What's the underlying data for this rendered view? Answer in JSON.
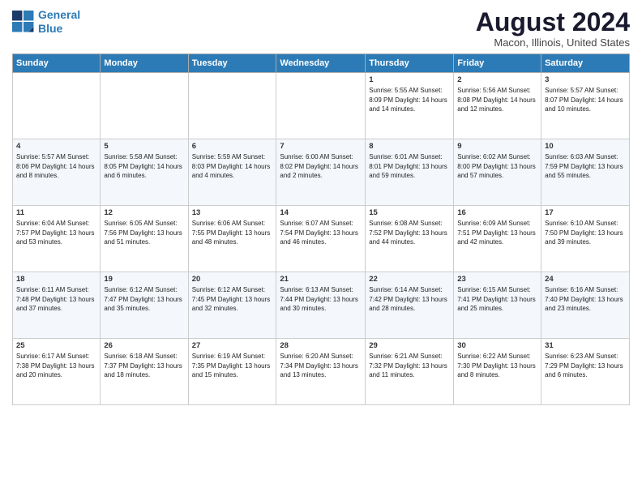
{
  "header": {
    "logo_line1": "General",
    "logo_line2": "Blue",
    "title": "August 2024",
    "subtitle": "Macon, Illinois, United States"
  },
  "weekdays": [
    "Sunday",
    "Monday",
    "Tuesday",
    "Wednesday",
    "Thursday",
    "Friday",
    "Saturday"
  ],
  "weeks": [
    [
      {
        "day": "",
        "info": ""
      },
      {
        "day": "",
        "info": ""
      },
      {
        "day": "",
        "info": ""
      },
      {
        "day": "",
        "info": ""
      },
      {
        "day": "1",
        "info": "Sunrise: 5:55 AM\nSunset: 8:09 PM\nDaylight: 14 hours\nand 14 minutes."
      },
      {
        "day": "2",
        "info": "Sunrise: 5:56 AM\nSunset: 8:08 PM\nDaylight: 14 hours\nand 12 minutes."
      },
      {
        "day": "3",
        "info": "Sunrise: 5:57 AM\nSunset: 8:07 PM\nDaylight: 14 hours\nand 10 minutes."
      }
    ],
    [
      {
        "day": "4",
        "info": "Sunrise: 5:57 AM\nSunset: 8:06 PM\nDaylight: 14 hours\nand 8 minutes."
      },
      {
        "day": "5",
        "info": "Sunrise: 5:58 AM\nSunset: 8:05 PM\nDaylight: 14 hours\nand 6 minutes."
      },
      {
        "day": "6",
        "info": "Sunrise: 5:59 AM\nSunset: 8:03 PM\nDaylight: 14 hours\nand 4 minutes."
      },
      {
        "day": "7",
        "info": "Sunrise: 6:00 AM\nSunset: 8:02 PM\nDaylight: 14 hours\nand 2 minutes."
      },
      {
        "day": "8",
        "info": "Sunrise: 6:01 AM\nSunset: 8:01 PM\nDaylight: 13 hours\nand 59 minutes."
      },
      {
        "day": "9",
        "info": "Sunrise: 6:02 AM\nSunset: 8:00 PM\nDaylight: 13 hours\nand 57 minutes."
      },
      {
        "day": "10",
        "info": "Sunrise: 6:03 AM\nSunset: 7:59 PM\nDaylight: 13 hours\nand 55 minutes."
      }
    ],
    [
      {
        "day": "11",
        "info": "Sunrise: 6:04 AM\nSunset: 7:57 PM\nDaylight: 13 hours\nand 53 minutes."
      },
      {
        "day": "12",
        "info": "Sunrise: 6:05 AM\nSunset: 7:56 PM\nDaylight: 13 hours\nand 51 minutes."
      },
      {
        "day": "13",
        "info": "Sunrise: 6:06 AM\nSunset: 7:55 PM\nDaylight: 13 hours\nand 48 minutes."
      },
      {
        "day": "14",
        "info": "Sunrise: 6:07 AM\nSunset: 7:54 PM\nDaylight: 13 hours\nand 46 minutes."
      },
      {
        "day": "15",
        "info": "Sunrise: 6:08 AM\nSunset: 7:52 PM\nDaylight: 13 hours\nand 44 minutes."
      },
      {
        "day": "16",
        "info": "Sunrise: 6:09 AM\nSunset: 7:51 PM\nDaylight: 13 hours\nand 42 minutes."
      },
      {
        "day": "17",
        "info": "Sunrise: 6:10 AM\nSunset: 7:50 PM\nDaylight: 13 hours\nand 39 minutes."
      }
    ],
    [
      {
        "day": "18",
        "info": "Sunrise: 6:11 AM\nSunset: 7:48 PM\nDaylight: 13 hours\nand 37 minutes."
      },
      {
        "day": "19",
        "info": "Sunrise: 6:12 AM\nSunset: 7:47 PM\nDaylight: 13 hours\nand 35 minutes."
      },
      {
        "day": "20",
        "info": "Sunrise: 6:12 AM\nSunset: 7:45 PM\nDaylight: 13 hours\nand 32 minutes."
      },
      {
        "day": "21",
        "info": "Sunrise: 6:13 AM\nSunset: 7:44 PM\nDaylight: 13 hours\nand 30 minutes."
      },
      {
        "day": "22",
        "info": "Sunrise: 6:14 AM\nSunset: 7:42 PM\nDaylight: 13 hours\nand 28 minutes."
      },
      {
        "day": "23",
        "info": "Sunrise: 6:15 AM\nSunset: 7:41 PM\nDaylight: 13 hours\nand 25 minutes."
      },
      {
        "day": "24",
        "info": "Sunrise: 6:16 AM\nSunset: 7:40 PM\nDaylight: 13 hours\nand 23 minutes."
      }
    ],
    [
      {
        "day": "25",
        "info": "Sunrise: 6:17 AM\nSunset: 7:38 PM\nDaylight: 13 hours\nand 20 minutes."
      },
      {
        "day": "26",
        "info": "Sunrise: 6:18 AM\nSunset: 7:37 PM\nDaylight: 13 hours\nand 18 minutes."
      },
      {
        "day": "27",
        "info": "Sunrise: 6:19 AM\nSunset: 7:35 PM\nDaylight: 13 hours\nand 15 minutes."
      },
      {
        "day": "28",
        "info": "Sunrise: 6:20 AM\nSunset: 7:34 PM\nDaylight: 13 hours\nand 13 minutes."
      },
      {
        "day": "29",
        "info": "Sunrise: 6:21 AM\nSunset: 7:32 PM\nDaylight: 13 hours\nand 11 minutes."
      },
      {
        "day": "30",
        "info": "Sunrise: 6:22 AM\nSunset: 7:30 PM\nDaylight: 13 hours\nand 8 minutes."
      },
      {
        "day": "31",
        "info": "Sunrise: 6:23 AM\nSunset: 7:29 PM\nDaylight: 13 hours\nand 6 minutes."
      }
    ]
  ]
}
